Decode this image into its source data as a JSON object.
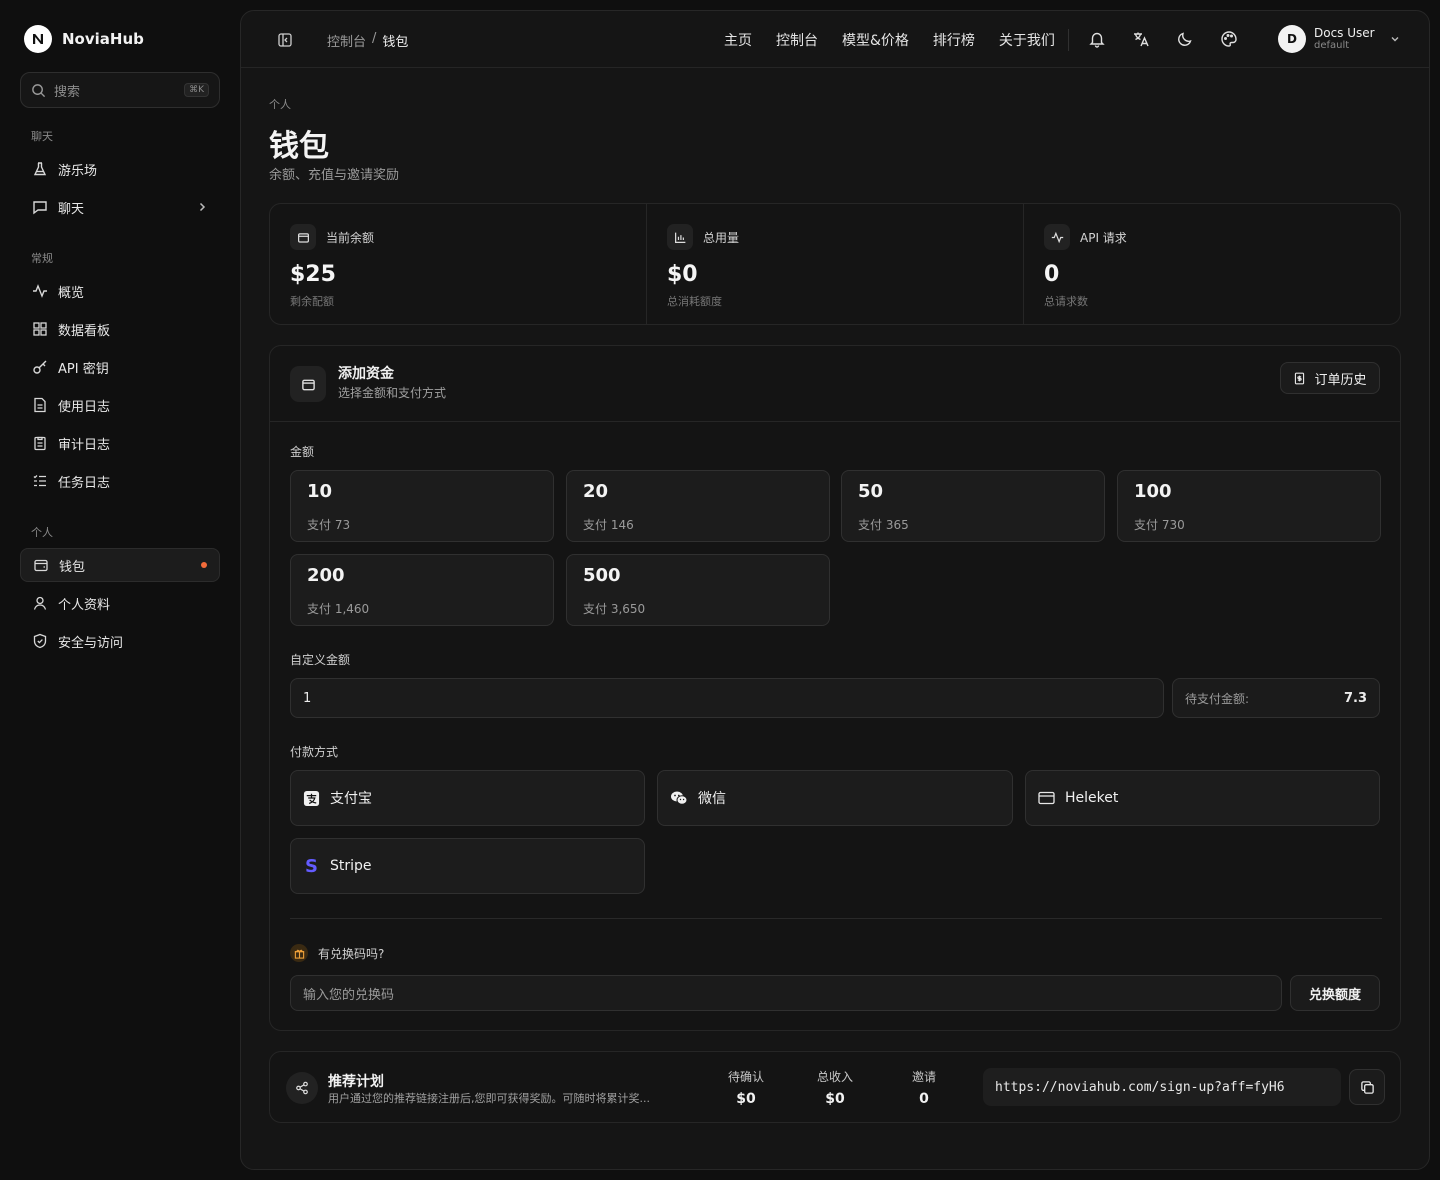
{
  "app": {
    "brand": "NoviaHub"
  },
  "sidebar": {
    "search": {
      "placeholder": "搜索",
      "shortcut": "⌘K"
    },
    "groups": [
      {
        "label": "聊天",
        "items": [
          {
            "label": "游乐场",
            "icon": "flask-icon"
          },
          {
            "label": "聊天",
            "icon": "chat-icon"
          }
        ]
      },
      {
        "label": "常规",
        "items": [
          {
            "label": "概览",
            "icon": "activity-icon"
          },
          {
            "label": "数据看板",
            "icon": "dashboard-icon"
          },
          {
            "label": "API 密钥",
            "icon": "key-icon"
          },
          {
            "label": "使用日志",
            "icon": "file-icon"
          },
          {
            "label": "审计日志",
            "icon": "clipboard-icon"
          },
          {
            "label": "任务日志",
            "icon": "list-icon"
          }
        ]
      },
      {
        "label": "个人",
        "items": [
          {
            "label": "钱包",
            "icon": "wallet-icon",
            "active": true
          },
          {
            "label": "个人资料",
            "icon": "user-icon"
          },
          {
            "label": "安全与访问",
            "icon": "shield-icon"
          }
        ]
      }
    ]
  },
  "topbar": {
    "breadcrumb": {
      "parent": "控制台",
      "separator": "/",
      "current": "钱包"
    },
    "nav": [
      "主页",
      "控制台",
      "模型&价格",
      "排行榜",
      "关于我们"
    ],
    "user": {
      "initial": "D",
      "name": "Docs User",
      "group": "default"
    }
  },
  "page": {
    "kicker": "个人",
    "title": "钱包",
    "subtitle": "余额、充值与邀请奖励"
  },
  "stats": [
    {
      "label": "当前余额",
      "value": "$25",
      "sub": "剩余配额",
      "icon": "wallet-icon"
    },
    {
      "label": "总用量",
      "value": "$0",
      "sub": "总消耗额度",
      "icon": "bar-chart-icon"
    },
    {
      "label": "API 请求",
      "value": "0",
      "sub": "总请求数",
      "icon": "activity-icon"
    }
  ],
  "fund": {
    "title": "添加资金",
    "subtitle": "选择金额和支付方式",
    "history_button": "订单历史",
    "amount_label": "金额",
    "amounts": [
      {
        "value": "10",
        "pay": "支付 73"
      },
      {
        "value": "20",
        "pay": "支付 146"
      },
      {
        "value": "50",
        "pay": "支付 365"
      },
      {
        "value": "100",
        "pay": "支付 730"
      },
      {
        "value": "200",
        "pay": "支付 1,460"
      },
      {
        "value": "500",
        "pay": "支付 3,650"
      }
    ],
    "custom_label": "自定义金额",
    "custom_value": "1",
    "pending_label": "待支付金额:",
    "pending_value": "7.3",
    "method_label": "付款方式",
    "methods": [
      {
        "label": "支付宝",
        "icon": "alipay-icon"
      },
      {
        "label": "微信",
        "icon": "wechat-icon"
      },
      {
        "label": "Heleket",
        "icon": "card-icon"
      },
      {
        "label": "Stripe",
        "icon": "stripe-icon"
      }
    ],
    "redeem_label": "有兑换码吗?",
    "redeem_placeholder": "输入您的兑换码",
    "redeem_button": "兑换额度"
  },
  "referral": {
    "title": "推荐计划",
    "description": "用户通过您的推荐链接注册后,您即可获得奖励。可随时将累计奖...",
    "stats": [
      {
        "label": "待确认",
        "value": "$0"
      },
      {
        "label": "总收入",
        "value": "$0"
      },
      {
        "label": "邀请",
        "value": "0"
      }
    ],
    "link": "https://noviahub.com/sign-up?aff=fyH6"
  },
  "colors": {
    "background": "#0f0f0f",
    "panel": "#151515",
    "accent_dot": "#f26b3a",
    "stripe": "#635bff"
  }
}
